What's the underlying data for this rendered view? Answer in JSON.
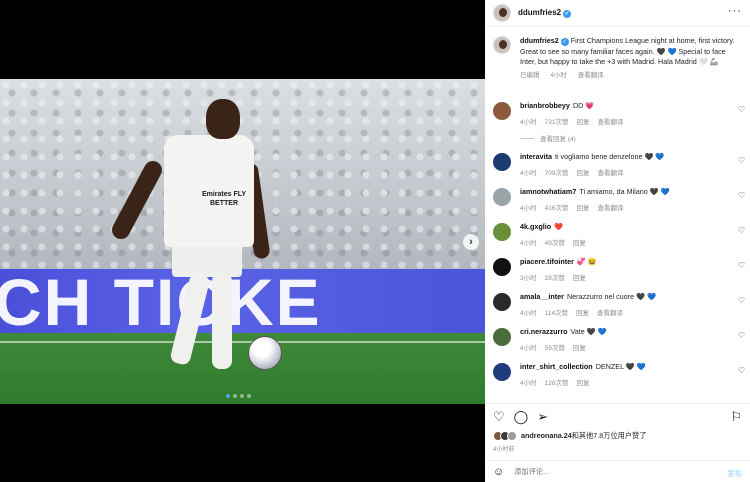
{
  "media": {
    "banner_text": "CH TICKE",
    "sponsor_text": "Emirates FLY BETTER",
    "carousel_dots": 4,
    "active_dot": 0,
    "next_arrow": "›"
  },
  "post": {
    "author": "ddumfries2",
    "more": "···",
    "caption_author": "ddumfries2",
    "caption": "First Champions League night at home, first victory. Great to see so many familiar faces again. 🖤 💙 Special to face Inter, but happy to take the +3 with Madrid. Hala Madrid 🤍 🦾",
    "edited": "已编辑",
    "time": "4小时",
    "translate": "查看翻译"
  },
  "comments": [
    {
      "user": "brianbrobbeyy",
      "text": "DD 💗",
      "time": "4小时",
      "likes": "731次赞",
      "reply": "回复",
      "translate": "查看翻译",
      "avatar_color": "#8b5a3c",
      "replies": "查看回复 (4)"
    },
    {
      "user": "interavita",
      "text": "ti vogliamo bene denzelone 🖤 💙",
      "time": "4小时",
      "likes": "709次赞",
      "reply": "回复",
      "translate": "查看翻译",
      "avatar_color": "#1d3b6e"
    },
    {
      "user": "iamnotwhatiam7",
      "text": "Ti amiamo, da Milano 🖤 💙",
      "time": "4小时",
      "likes": "416次赞",
      "reply": "回复",
      "translate": "查看翻译",
      "avatar_color": "#9aa3a8"
    },
    {
      "user": "4k.gxglio",
      "text": "❤️",
      "time": "4小时",
      "likes": "49次赞",
      "reply": "回复",
      "translate": "",
      "avatar_color": "#6b8e3a"
    },
    {
      "user": "piacere.tifointer",
      "text": "💞 😆",
      "time": "3小时",
      "likes": "28次赞",
      "reply": "回复",
      "translate": "",
      "avatar_color": "#111111"
    },
    {
      "user": "amala__inter",
      "text": "Nerazzurro nel cuore 🖤 💙",
      "time": "4小时",
      "likes": "114次赞",
      "reply": "回复",
      "translate": "查看翻译",
      "avatar_color": "#2a2a2a"
    },
    {
      "user": "cri.nerazzurro",
      "text": "Vate 🖤 💙",
      "time": "4小时",
      "likes": "59次赞",
      "reply": "回复",
      "translate": "",
      "avatar_color": "#4a6b3a"
    },
    {
      "user": "inter_shirt_collection",
      "text": "DENZEL 🖤 💙",
      "time": "4小时",
      "likes": "128次赞",
      "reply": "回复",
      "translate": "",
      "avatar_color": "#1e3d7a"
    }
  ],
  "actions": {
    "like_icon": "heart-icon",
    "comment_icon": "comment-icon",
    "share_icon": "share-icon",
    "save_icon": "bookmark-icon"
  },
  "likes": {
    "user": "andreonana.24",
    "text": "和其他7.8万位用户赞了"
  },
  "time_ago": "4小时前",
  "add_comment": {
    "placeholder": "添加评论...",
    "post_label": "发布"
  }
}
